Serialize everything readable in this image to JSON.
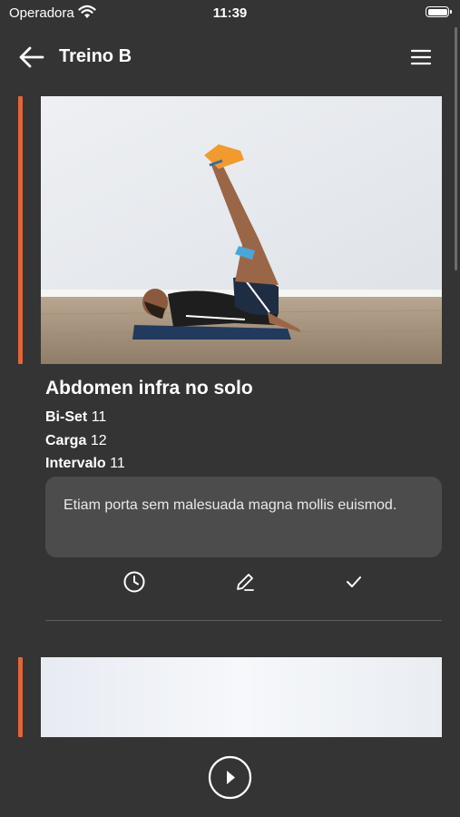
{
  "status_bar": {
    "carrier": "Operadora",
    "time": "11:39"
  },
  "nav": {
    "title": "Treino B"
  },
  "colors": {
    "background": "#353434",
    "accent": "#e0663a",
    "note_background": "#4d4c4c"
  },
  "exercise": {
    "title": "Abdomen infra no solo",
    "details": [
      {
        "label": "Bi-Set",
        "value": "11"
      },
      {
        "label": "Carga",
        "value": "12"
      },
      {
        "label": "Intervalo",
        "value": "11"
      }
    ],
    "note": "Etiam porta sem malesuada magna mollis euismod.",
    "actions": [
      "clock-icon",
      "pencil-icon",
      "check-icon"
    ]
  },
  "footer": {
    "play_icon": "play-icon"
  }
}
